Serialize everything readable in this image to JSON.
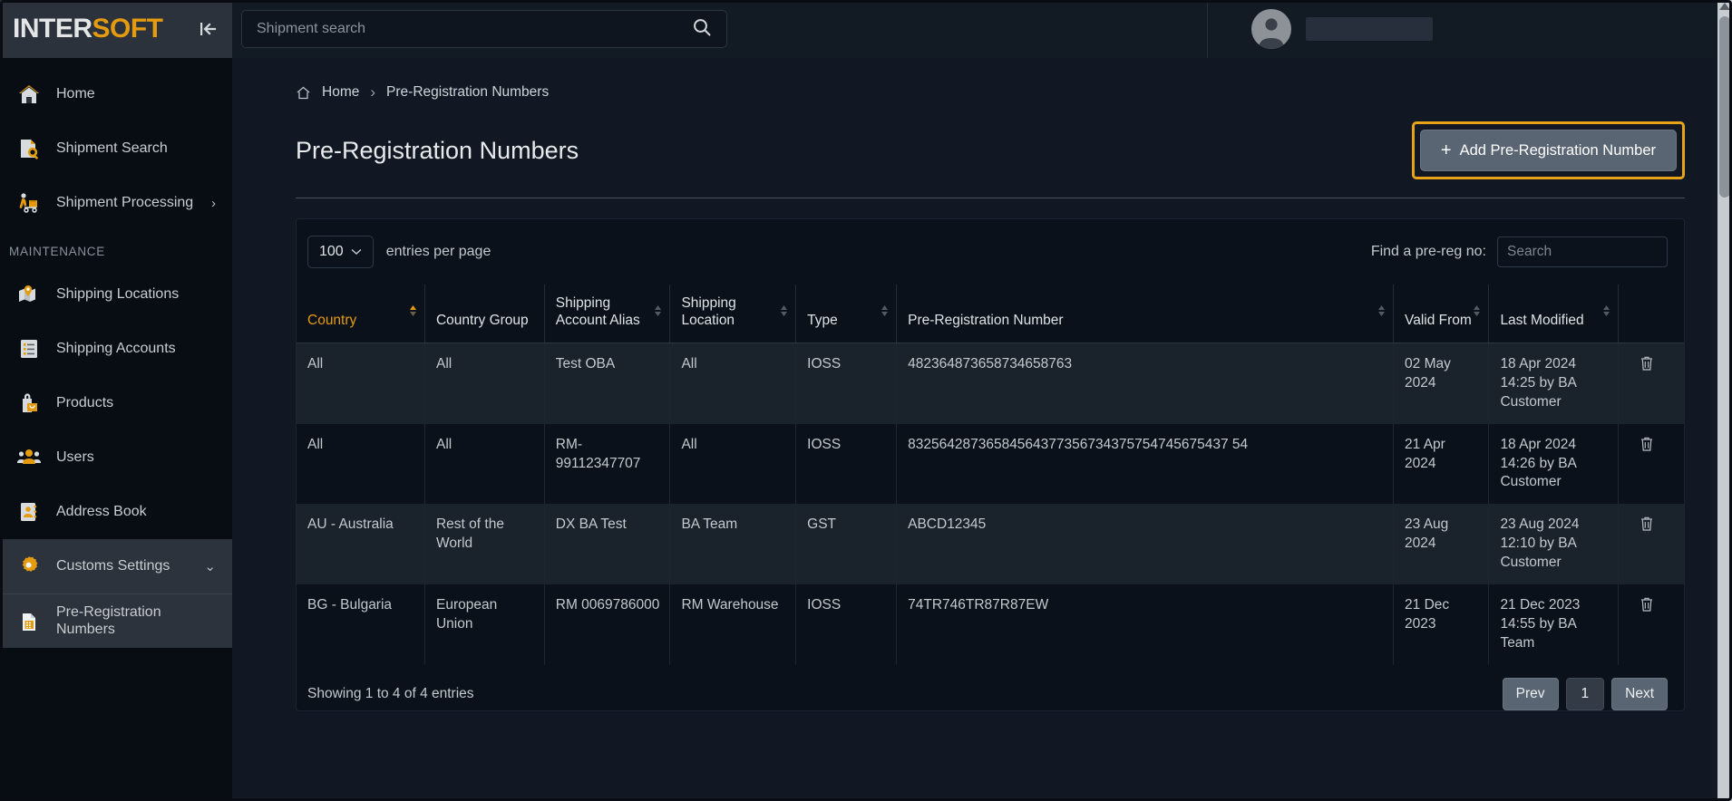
{
  "brand": {
    "part1": "INTER",
    "part2": "SOFT",
    "collapse_title": "Collapse menu"
  },
  "topbar": {
    "search_placeholder": "Shipment search",
    "search_value": ""
  },
  "sidebar": {
    "section_label": "MAINTENANCE",
    "items": [
      {
        "label": "Home",
        "icon": "home-icon"
      },
      {
        "label": "Shipment Search",
        "icon": "document-search-icon"
      },
      {
        "label": "Shipment Processing",
        "icon": "delivery-cart-icon",
        "chevron": "›"
      }
    ],
    "maintenance_items": [
      {
        "label": "Shipping Locations",
        "icon": "map-pin-icon"
      },
      {
        "label": "Shipping Accounts",
        "icon": "list-icon"
      },
      {
        "label": "Products",
        "icon": "bag-icon"
      },
      {
        "label": "Users",
        "icon": "users-icon"
      },
      {
        "label": "Address Book",
        "icon": "address-book-icon"
      },
      {
        "label": "Customs Settings",
        "icon": "gear-icon",
        "chevron": "⌄",
        "active": true
      }
    ],
    "sub_item": {
      "label": "Pre-Registration Numbers",
      "icon": "spreadsheet-icon"
    }
  },
  "breadcrumb": {
    "home": "Home",
    "separator": "›",
    "current": "Pre-Registration Numbers"
  },
  "page": {
    "title": "Pre-Registration Numbers",
    "add_button": "Add Pre-Registration Number",
    "add_button_plus": "+"
  },
  "table_controls": {
    "entries_value": "100",
    "entries_label": "entries per page",
    "find_label": "Find a pre-reg no:",
    "find_placeholder": "Search",
    "find_value": ""
  },
  "table": {
    "headers": [
      {
        "label": "Country",
        "sorted": true,
        "sort_dir": "asc"
      },
      {
        "label": "Country Group",
        "sorted": false
      },
      {
        "label": "Shipping Account Alias",
        "sorted": false
      },
      {
        "label": "Shipping Location",
        "sorted": false
      },
      {
        "label": "Type",
        "sorted": false
      },
      {
        "label": "Pre-Registration Number",
        "sorted": false
      },
      {
        "label": "Valid From",
        "sorted": false
      },
      {
        "label": "Last Modified",
        "sorted": false
      },
      {
        "label": "",
        "sorted": false
      }
    ],
    "rows": [
      {
        "country": "All",
        "country_group": "All",
        "account_alias": "Test OBA",
        "shipping_location": "All",
        "type": "IOSS",
        "prereg_number": "482364873658734658763",
        "valid_from": "02 May 2024",
        "last_modified": "18 Apr 2024 14:25 by BA Customer",
        "delete_icon": "trash-icon"
      },
      {
        "country": "All",
        "country_group": "All",
        "account_alias": "RM-99112347707",
        "shipping_location": "All",
        "type": "IOSS",
        "prereg_number": "83256428736584564377356734375754745675437 54",
        "valid_from": "21 Apr 2024",
        "last_modified": "18 Apr 2024 14:26 by BA Customer",
        "delete_icon": "trash-icon"
      },
      {
        "country": "AU - Australia",
        "country_group": "Rest of the World",
        "account_alias": "DX BA Test",
        "shipping_location": "BA Team",
        "type": "GST",
        "prereg_number": "ABCD12345",
        "valid_from": "23 Aug 2024",
        "last_modified": "23 Aug 2024 12:10 by BA Customer",
        "delete_icon": "trash-icon"
      },
      {
        "country": "BG - Bulgaria",
        "country_group": "European Union",
        "account_alias": "RM 0069786000",
        "shipping_location": "RM Warehouse",
        "type": "IOSS",
        "prereg_number": "74TR746TR87R87EW",
        "valid_from": "21 Dec 2023",
        "last_modified": "21 Dec 2023 14:55 by BA Team",
        "delete_icon": "trash-icon"
      }
    ]
  },
  "footer": {
    "showing": "Showing 1 to 4 of 4 entries",
    "prev": "Prev",
    "page_number": "1",
    "next": "Next"
  },
  "colors": {
    "accent": "#e49b0f",
    "highlight": "#e8a317",
    "sidebar_bg": "#080d14",
    "panel_bg": "#0b111a"
  }
}
